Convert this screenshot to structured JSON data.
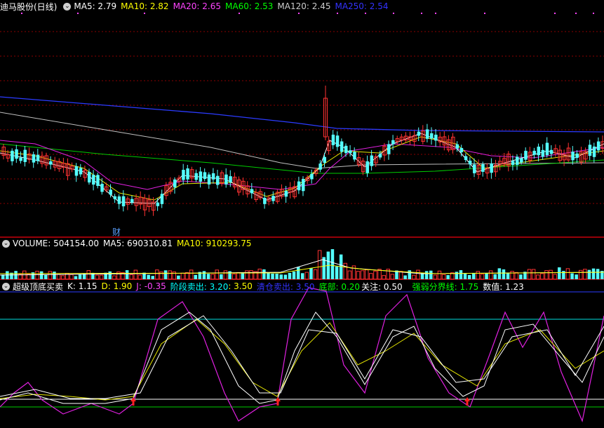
{
  "main": {
    "title": "迪马股份(日线)",
    "ma": [
      {
        "label": "MA5: 2.79",
        "color": "#ffffff"
      },
      {
        "label": "MA10: 2.82",
        "color": "#ffff00"
      },
      {
        "label": "MA20: 2.65",
        "color": "#ff44ff"
      },
      {
        "label": "MA60: 2.53",
        "color": "#00ff00"
      },
      {
        "label": "MA120: 2.45",
        "color": "#cccccc"
      },
      {
        "label": "MA250: 2.54",
        "color": "#3333ff"
      }
    ],
    "marker_text": "财"
  },
  "volume": {
    "label": "VOLUME: 504154.00",
    "ma5": "MA5: 690310.81",
    "ma10": "MA10: 910293.75"
  },
  "indicator": {
    "name": "超级顶底买卖",
    "items": [
      {
        "label": "K: 1.15",
        "color": "#ffffff"
      },
      {
        "label": "D: 1.90",
        "color": "#ffff00"
      },
      {
        "label": "J: -0.35",
        "color": "#ff44ff"
      },
      {
        "label": "阶段卖出: 3.20",
        "color": "#00ffff"
      },
      {
        "label": ": 3.50",
        "color": "#ffff00"
      },
      {
        "label": "清仓卖出: 3.50",
        "color": "#3333ff"
      },
      {
        "label": "底部: 0.20",
        "color": "#00ff00"
      },
      {
        "label": "关注: 0.50",
        "color": "#ffffff"
      },
      {
        "label": "强弱分界线: 1.75",
        "color": "#00ff00"
      },
      {
        "label": "数值: 1.23",
        "color": "#ffffff"
      }
    ]
  },
  "colors": {
    "up": "#ff3232",
    "down": "#54ffff",
    "separator": "#c8000a",
    "grid": "#8c0000"
  }
}
